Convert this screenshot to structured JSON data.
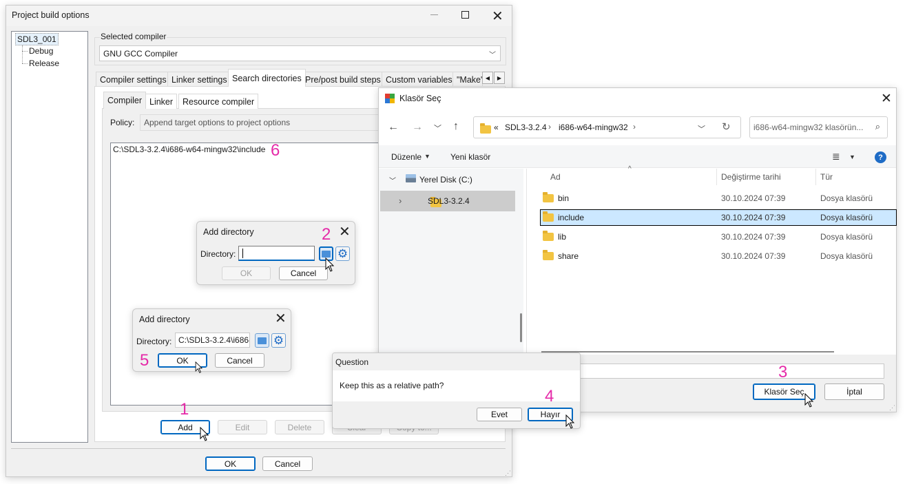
{
  "main_window": {
    "title": "Project build options",
    "tree": [
      "SDL3_001",
      "Debug",
      "Release"
    ],
    "selected_compiler_label": "Selected compiler",
    "selected_compiler_value": "GNU GCC Compiler",
    "tabs": [
      "Compiler settings",
      "Linker settings",
      "Search directories",
      "Pre/post build steps",
      "Custom variables",
      "\"Make\""
    ],
    "sub_tabs": [
      "Compiler",
      "Linker",
      "Resource compiler"
    ],
    "policy_label": "Policy:",
    "policy_value": "Append target options to project options",
    "directory_entry": "C:\\SDL3-3.2.4\\i686-w64-mingw32\\include",
    "buttons": {
      "add": "Add",
      "edit": "Edit",
      "delete": "Delete",
      "clear": "Clear",
      "copy_to": "Copy to...",
      "ok": "OK",
      "cancel": "Cancel"
    }
  },
  "add_dir_1": {
    "title": "Add directory",
    "label": "Directory:",
    "value": "",
    "ok": "OK",
    "cancel": "Cancel"
  },
  "add_dir_2": {
    "title": "Add directory",
    "label": "Directory:",
    "value": "C:\\SDL3-3.2.4\\i686-",
    "ok": "OK",
    "cancel": "Cancel"
  },
  "folder_dialog": {
    "title": "Klasör Seç",
    "breadcrumb": [
      "«",
      "SDL3-3.2.4",
      "i686-w64-mingw32"
    ],
    "search_placeholder": "i686-w64-mingw32 klasörün...",
    "toolbar": {
      "organize": "Düzenle",
      "new_folder": "Yeni klasör"
    },
    "nav": [
      "Yerel Disk (C:)",
      "SDL3-3.2.4"
    ],
    "columns": [
      "Ad",
      "Değiştirme tarihi",
      "Tür"
    ],
    "files": [
      {
        "name": "bin",
        "date": "30.10.2024 07:39",
        "type": "Dosya klasörü"
      },
      {
        "name": "include",
        "date": "30.10.2024 07:39",
        "type": "Dosya klasörü"
      },
      {
        "name": "lib",
        "date": "30.10.2024 07:39",
        "type": "Dosya klasörü"
      },
      {
        "name": "share",
        "date": "30.10.2024 07:39",
        "type": "Dosya klasörü"
      }
    ],
    "select_button": "Klasör Seç",
    "cancel_button": "İptal"
  },
  "question_dialog": {
    "title": "Question",
    "message": "Keep this as a relative path?",
    "yes": "Evet",
    "no": "Hayır"
  },
  "step_numbers": [
    "1",
    "2",
    "3",
    "4",
    "5",
    "6"
  ],
  "colors": {
    "accent": "#0067c0",
    "step_number": "#e52aa8",
    "selection": "#cce8ff",
    "folder": "#f2c442"
  }
}
